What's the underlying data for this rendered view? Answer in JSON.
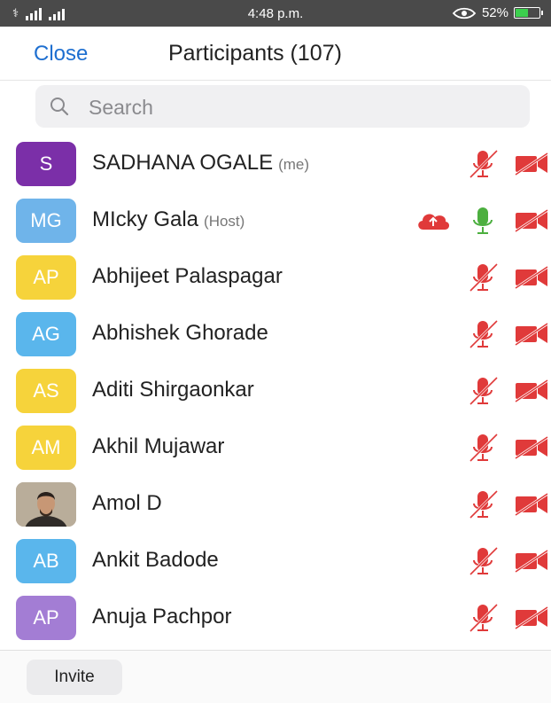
{
  "status": {
    "carrier": "⚕",
    "time": "4:48 p.m.",
    "battery": "52%",
    "battery_level": 0.52
  },
  "header": {
    "close_label": "Close",
    "title": "Participants (107)"
  },
  "search": {
    "placeholder": "Search"
  },
  "colors": {
    "accent": "#1e6fd0",
    "muted_red": "#e03a3a",
    "active_green": "#4caf3f"
  },
  "participants": [
    {
      "initials": "S",
      "name": "SADHANA OGALE",
      "tag": "(me)",
      "color": "#7b2fa8",
      "mic": "muted",
      "video": "off"
    },
    {
      "initials": "MG",
      "name": "MIcky Gala",
      "tag": "(Host)",
      "color": "#6fb4ea",
      "mic": "active",
      "video": "off",
      "cloud": true
    },
    {
      "initials": "AP",
      "name": "Abhijeet Palaspagar",
      "tag": "",
      "color": "#f6d33b",
      "mic": "muted",
      "video": "off"
    },
    {
      "initials": "AG",
      "name": "Abhishek Ghorade",
      "tag": "",
      "color": "#5ab6ec",
      "mic": "muted",
      "video": "off"
    },
    {
      "initials": "AS",
      "name": "Aditi Shirgaonkar",
      "tag": "",
      "color": "#f6d33b",
      "mic": "muted",
      "video": "off"
    },
    {
      "initials": "AM",
      "name": "Akhil Mujawar",
      "tag": "",
      "color": "#f6d33b",
      "mic": "muted",
      "video": "off"
    },
    {
      "initials": "",
      "name": "Amol D",
      "tag": "",
      "color": "#8a7460",
      "mic": "muted",
      "video": "off",
      "photo": true
    },
    {
      "initials": "AB",
      "name": "Ankit Badode",
      "tag": "",
      "color": "#5ab6ec",
      "mic": "muted",
      "video": "off"
    },
    {
      "initials": "AP",
      "name": "Anuja Pachpor",
      "tag": "",
      "color": "#a37dd4",
      "mic": "muted",
      "video": "off"
    }
  ],
  "footer": {
    "invite_label": "Invite"
  }
}
